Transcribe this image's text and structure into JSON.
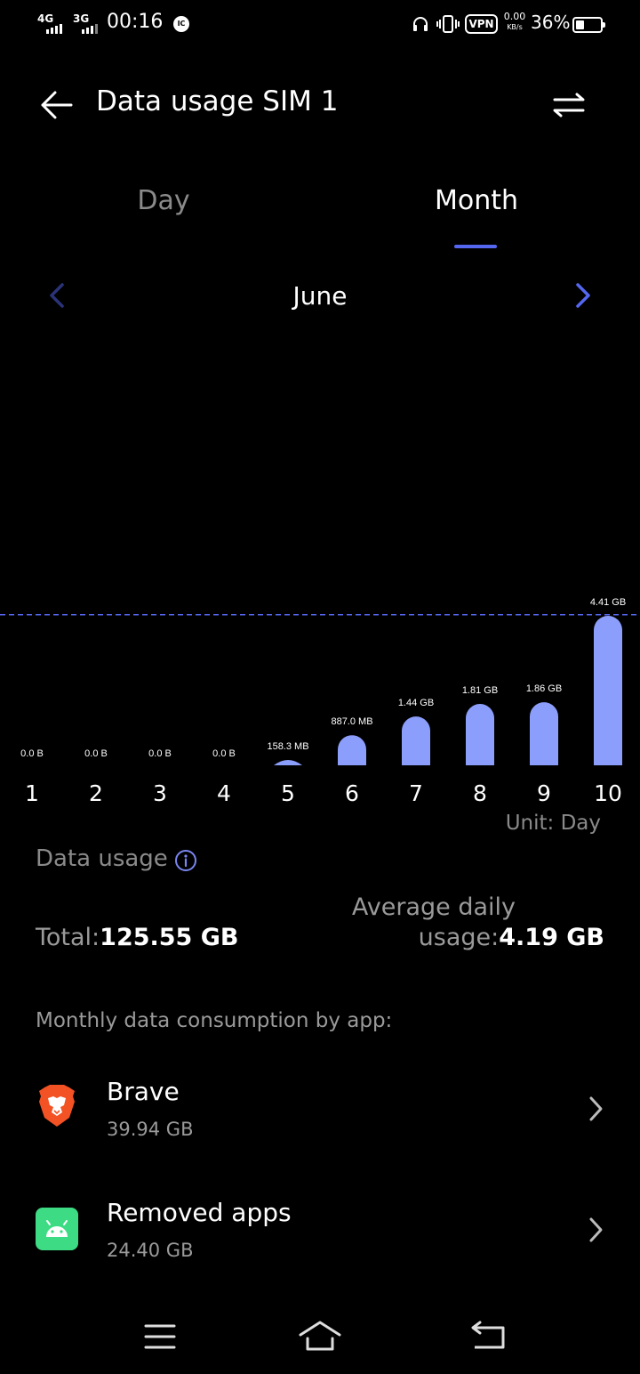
{
  "status_bar": {
    "network_1": "4G",
    "network_2": "3G",
    "time": "00:16",
    "notification_badge": "IC",
    "vpn": "VPN",
    "speed_value": "0.00",
    "speed_unit": "KB/s",
    "battery_percent": "36%",
    "battery_level": 0.36
  },
  "header": {
    "title": "Data usage SIM 1"
  },
  "tabs": {
    "day": "Day",
    "month": "Month",
    "active": "month"
  },
  "period": {
    "label": "June"
  },
  "chart_data": {
    "type": "bar",
    "categories": [
      "1",
      "2",
      "3",
      "4",
      "5",
      "6",
      "7",
      "8",
      "9",
      "10"
    ],
    "values_gb": [
      0,
      0,
      0,
      0,
      0.1583,
      0.887,
      1.44,
      1.81,
      1.86,
      4.41
    ],
    "data_labels": [
      "0.0 B",
      "0.0 B",
      "0.0 B",
      "0.0 B",
      "158.3 MB",
      "887.0 MB",
      "1.44 GB",
      "1.81 GB",
      "1.86 GB",
      "4.41 GB"
    ],
    "reference_line_gb": 4.19,
    "reference_line_style": "dashed",
    "bar_color": "#8c9efb",
    "line_color": "#5567f0"
  },
  "unit_label": "Unit: Day",
  "summary": {
    "title": "Data usage",
    "total_label": "Total:",
    "total_value": "125.55 GB",
    "avg_label_line1": "Average daily",
    "avg_label_line2": "usage:",
    "avg_value": "4.19 GB"
  },
  "apps_section": {
    "title": "Monthly data consumption by app:",
    "apps": [
      {
        "name": "Brave",
        "size": "39.94 GB",
        "icon": "brave-lion-icon"
      },
      {
        "name": "Removed apps",
        "size": "24.40 GB",
        "icon": "android-icon"
      }
    ]
  },
  "colors": {
    "accent": "#5567f0",
    "bar": "#8c9efb",
    "brave": "#f25224",
    "android_bg": "#3ddc84"
  }
}
